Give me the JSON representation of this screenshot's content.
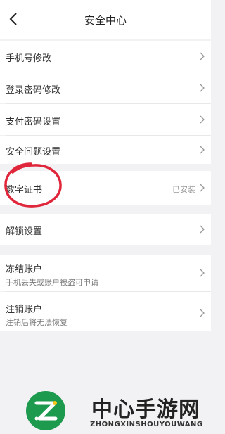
{
  "header": {
    "title": "安全中心"
  },
  "groups": [
    {
      "items": [
        {
          "label": "手机号修改"
        },
        {
          "label": "登录密码修改"
        },
        {
          "label": "支付密码设置"
        },
        {
          "label": "安全问题设置"
        }
      ]
    },
    {
      "items": [
        {
          "label": "数字证书",
          "value": "已安装"
        }
      ]
    },
    {
      "items": [
        {
          "label": "解锁设置"
        }
      ]
    },
    {
      "items": [
        {
          "label": "冻结账户",
          "sub": "手机丢失或账户被盗可申请"
        },
        {
          "label": "注销账户",
          "sub": "注销后将无法恢复"
        }
      ]
    }
  ],
  "watermark": {
    "name_cn": "中心手游网",
    "name_en": "ZHONGXINSHOUYOUWANG"
  },
  "colors": {
    "annotation_circle": "#e0263b",
    "logo_green": "#1e9a4f",
    "page_background": "#f2f2f4"
  },
  "icons": {
    "back": "chevron-left-icon",
    "row_arrow": "chevron-right-icon"
  }
}
